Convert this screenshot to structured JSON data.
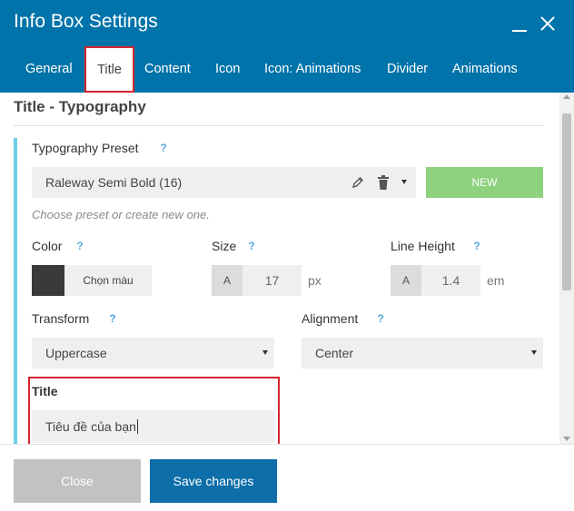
{
  "window": {
    "title": "Info Box Settings"
  },
  "tabs": [
    {
      "label": "General"
    },
    {
      "label": "Title"
    },
    {
      "label": "Content"
    },
    {
      "label": "Icon"
    },
    {
      "label": "Icon: Animations"
    },
    {
      "label": "Divider"
    },
    {
      "label": "Animations"
    }
  ],
  "active_tab": "Title",
  "section": {
    "title": "Title - Typography"
  },
  "typography_preset": {
    "label": "Typography Preset",
    "help": "?",
    "value": "Raleway Semi Bold (16)",
    "new_button": "NEW",
    "hint": "Choose preset or create new one."
  },
  "color": {
    "label": "Color",
    "help": "?",
    "swatch": "#3a3a3a",
    "button": "Chọn màu"
  },
  "size": {
    "label": "Size",
    "help": "?",
    "prefix": "A",
    "value": "17",
    "unit": "px"
  },
  "line_height": {
    "label": "Line Height",
    "help": "?",
    "prefix": "A",
    "value": "1.4",
    "unit": "em"
  },
  "transform": {
    "label": "Transform",
    "help": "?",
    "value": "Uppercase"
  },
  "alignment": {
    "label": "Alignment",
    "help": "?",
    "value": "Center"
  },
  "title_field": {
    "label": "Title",
    "value": "Tiêu đề của bạn"
  },
  "footer": {
    "close": "Close",
    "save": "Save changes"
  },
  "colors": {
    "header": "#0073aa",
    "new_button": "#8ed17f",
    "save_button": "#0d6ea9",
    "close_button": "#c2c2c2",
    "highlight": "#d6242f",
    "accent_bar": "#6fcfe8"
  }
}
